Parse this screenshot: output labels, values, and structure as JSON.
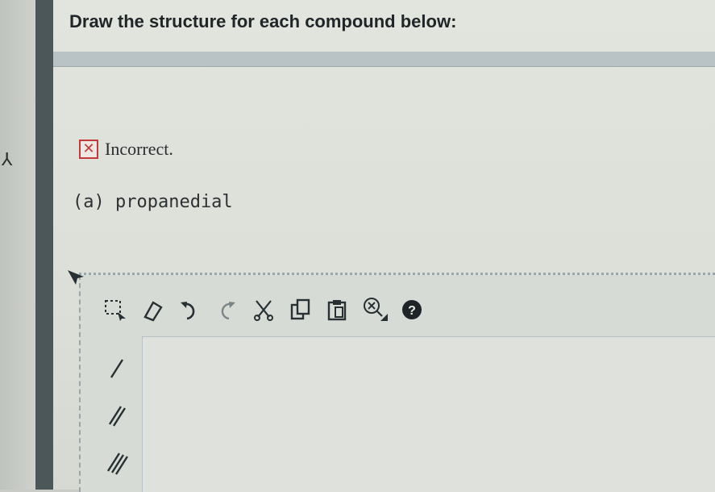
{
  "header": {
    "title": "Draw the structure for each compound below:"
  },
  "gutter": {
    "mark": "⅄"
  },
  "feedback": {
    "status_text": "Incorrect.",
    "status_icon": "red-x-icon",
    "status_color": "#c23a3a"
  },
  "question": {
    "label": "(a) propanedial"
  },
  "editor": {
    "toolbar": [
      "select-icon",
      "eraser-icon",
      "undo-icon",
      "redo-icon",
      "cut-icon",
      "copy-icon",
      "paste-icon",
      "zoom-icon",
      "help-icon"
    ],
    "bond_tools": [
      "single-bond-icon",
      "double-bond-icon",
      "triple-bond-icon"
    ]
  }
}
